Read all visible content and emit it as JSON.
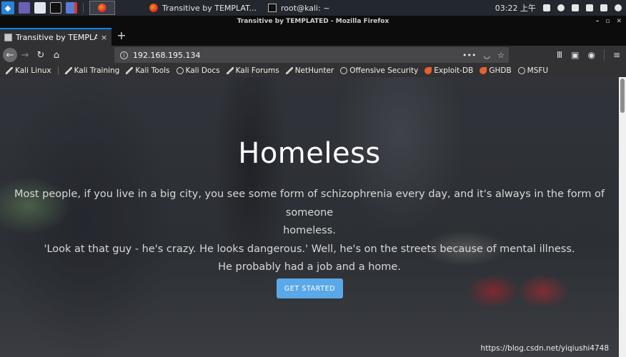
{
  "taskbar": {
    "tasks": [
      {
        "label": "Transitive by TEMPLAT..."
      },
      {
        "label": "root@kali: ~"
      }
    ],
    "clock": "03:22 上午"
  },
  "window": {
    "title": "Transitive by TEMPLATED - Mozilla Firefox"
  },
  "tab": {
    "label": "Transitive by TEMPLATED",
    "close": "×"
  },
  "nav": {
    "url": "192.168.195.134",
    "more": "•••"
  },
  "bookmarks": [
    {
      "label": "Kali Linux",
      "icon": "kali-icon"
    },
    {
      "label": "Kali Training",
      "icon": "kali-icon"
    },
    {
      "label": "Kali Tools",
      "icon": "kali-icon"
    },
    {
      "label": "Kali Docs",
      "icon": "globe-icon"
    },
    {
      "label": "Kali Forums",
      "icon": "kali-icon"
    },
    {
      "label": "NetHunter",
      "icon": "kali-icon"
    },
    {
      "label": "Offensive Security",
      "icon": "globe-icon"
    },
    {
      "label": "Exploit-DB",
      "icon": "exploit-icon"
    },
    {
      "label": "GHDB",
      "icon": "exploit-icon"
    },
    {
      "label": "MSFU",
      "icon": "globe-icon"
    }
  ],
  "hero": {
    "title": "Homeless",
    "lines": [
      "Most people, if you live in a big city, you see some form of schizophrenia every day, and it's always in the form of someone",
      "homeless.",
      "'Look at that guy - he's crazy. He looks dangerous.' Well, he's on the streets because of mental illness.",
      "He probably had a job and a home."
    ],
    "button": "GET STARTED"
  },
  "watermark": "https://blog.csdn.net/yiqiushi4748",
  "colors": {
    "button": "#5aa8e8",
    "tab_accent": "#0a84ff"
  }
}
